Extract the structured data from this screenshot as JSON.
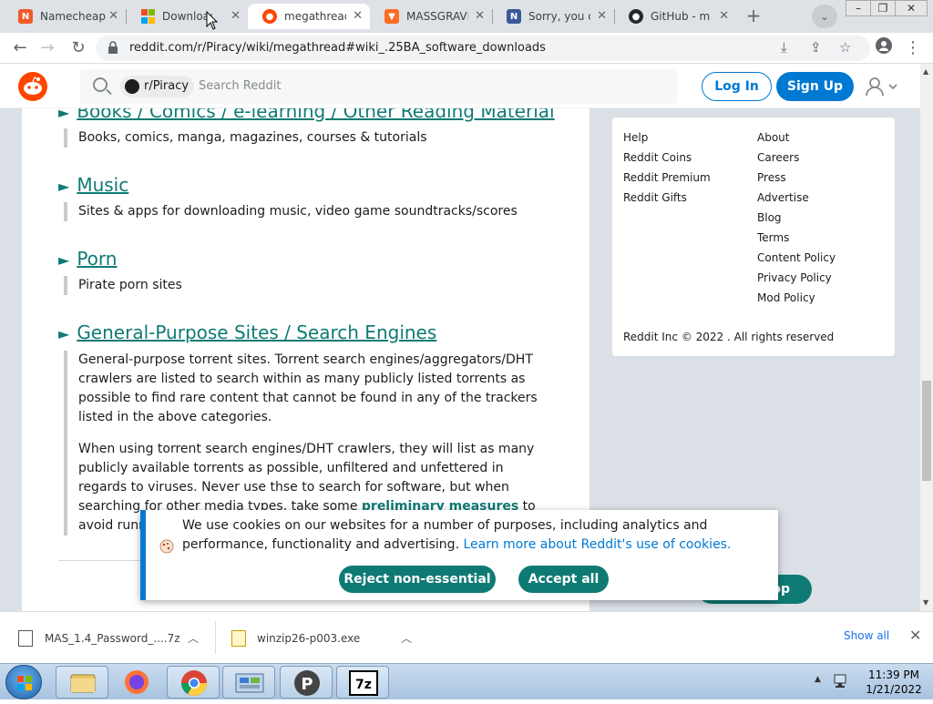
{
  "browser": {
    "tabs": [
      {
        "title": "Namecheap",
        "icon": "namecheap-icon",
        "color": "#f05a28"
      },
      {
        "title": "Download",
        "icon": "microsoft-icon",
        "color": "#f25022"
      },
      {
        "title": "megathread",
        "icon": "reddit-icon",
        "color": "#ff4500"
      },
      {
        "title": "MASSGRAVE",
        "icon": "gitlab-icon",
        "color": "#fc6d26"
      },
      {
        "title": "Sorry, you c",
        "icon": "notion-icon",
        "color": "#3b5998"
      },
      {
        "title": "GitHub - m",
        "icon": "github-icon",
        "color": "#24292e"
      }
    ],
    "address": "reddit.com/r/Piracy/wiki/megathread#wiki_.25BA_software_downloads"
  },
  "reddit": {
    "subreddit_chip": "r/Piracy",
    "search_placeholder": "Search Reddit",
    "login_label": "Log In",
    "signup_label": "Sign Up",
    "brand_color": "#ff4500",
    "accent_color": "#0079d3"
  },
  "sections": [
    {
      "heading": "Books / Comics / e-learning / Other Reading Material",
      "paragraphs": [
        "Books, comics, manga, magazines, courses & tutorials"
      ]
    },
    {
      "heading": "Music",
      "paragraphs": [
        "Sites & apps for downloading music, video game soundtracks/scores"
      ]
    },
    {
      "heading": "Porn",
      "paragraphs": [
        "Pirate porn sites"
      ]
    },
    {
      "heading": "General-Purpose Sites / Search Engines",
      "paragraphs": [
        "General-purpose torrent sites. Torrent search engines/aggregators/DHT crawlers are listed to search within as many publicly listed torrents as possible to find rare content that cannot be found in any of the trackers listed in the above categories.",
        "When using torrent search engines/DHT crawlers, they will list as many publicly available torrents as possible, unfiltered and unfettered in regards to viruses. Never use thse to search for software, but when searching for other media types, take some"
      ],
      "link_text": "preliminary measures",
      "trailing_text": "to avoid running malware."
    }
  ],
  "heading_marker": "►",
  "footer": {
    "col1": [
      "Help",
      "Reddit Coins",
      "Reddit Premium",
      "Reddit Gifts"
    ],
    "col2": [
      "About",
      "Careers",
      "Press",
      "Advertise",
      "Blog",
      "Terms",
      "Content Policy",
      "Privacy Policy",
      "Mod Policy"
    ],
    "copyright": "Reddit Inc © 2022 . All rights reserved"
  },
  "back_to_top_label": "op",
  "cookie_banner": {
    "message": "We use cookies on our websites for a number of purposes, including analytics and performance, functionality and advertising.",
    "link": "Learn more about Reddit's use of cookies.",
    "reject_label": "Reject non-essential",
    "accept_label": "Accept all"
  },
  "downloads": {
    "items": [
      {
        "name": "MAS_1.4_Password_....7z"
      },
      {
        "name": "winzip26-p003.exe"
      }
    ],
    "show_all": "Show all"
  },
  "taskbar": {
    "time": "11:39 PM",
    "date": "1/21/2022",
    "apps": [
      "file-explorer-icon",
      "firefox-icon",
      "chrome-icon",
      "control-panel-icon",
      "pcloud-icon",
      "7zip-icon"
    ]
  }
}
